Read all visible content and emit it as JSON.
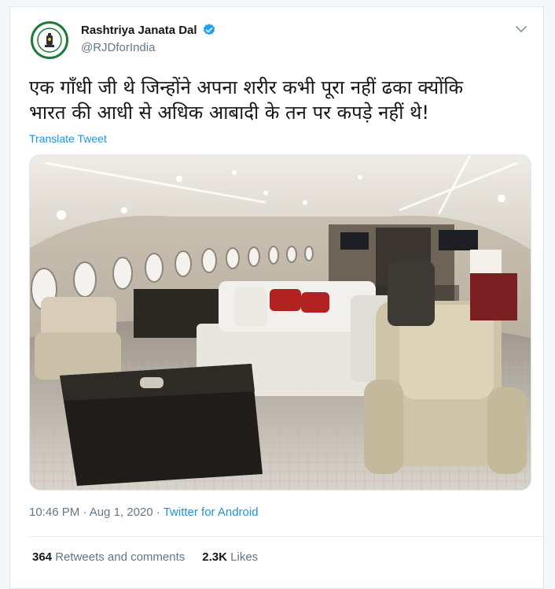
{
  "tweet": {
    "author": {
      "display_name": "Rashtriya Janata Dal",
      "handle": "@RJDforIndia",
      "verified": true
    },
    "text_line1": "एक गाँधी जी थे जिन्होंने अपना शरीर कभी पूरा नहीं ढका क्योंकि",
    "text_line2": "भारत की आधी से अधिक आबादी के तन पर कपड़े नहीं थे!",
    "translate_label": "Translate Tweet",
    "timestamp": "10:46 PM · Aug 1, 2020",
    "separator": " · ",
    "source": "Twitter for Android",
    "stats": {
      "retweets_count": "364",
      "retweets_label": "Retweets and comments",
      "likes_count": "2.3K",
      "likes_label": "Likes"
    }
  },
  "icons": {
    "avatar": "party-logo-icon",
    "verified": "verified-badge-icon",
    "menu": "chevron-down-icon"
  },
  "colors": {
    "link": "#1b95e0",
    "muted": "#657786",
    "verified": "#1da1f2",
    "logo_green": "#1f7a3a"
  }
}
